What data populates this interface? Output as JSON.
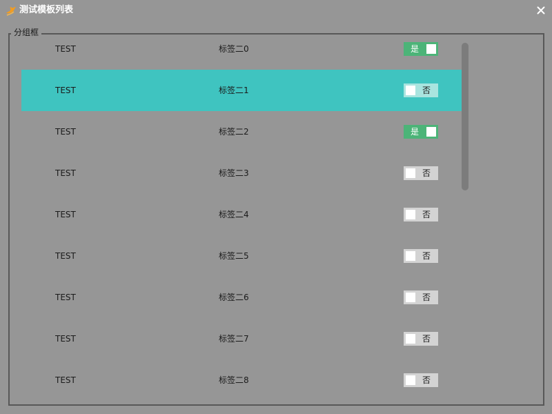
{
  "window": {
    "title": "测试模板列表",
    "app_icon": "bird-logo-icon",
    "close_icon": "close-icon"
  },
  "group": {
    "title": "分组框"
  },
  "list": {
    "selected_index": 1,
    "rows": [
      {
        "name": "TEST",
        "tag": "标签二0",
        "toggle_label": "是",
        "toggle_on": true
      },
      {
        "name": "TEST",
        "tag": "标签二1",
        "toggle_label": "否",
        "toggle_on": false
      },
      {
        "name": "TEST",
        "tag": "标签二2",
        "toggle_label": "是",
        "toggle_on": true
      },
      {
        "name": "TEST",
        "tag": "标签二3",
        "toggle_label": "否",
        "toggle_on": false
      },
      {
        "name": "TEST",
        "tag": "标签二4",
        "toggle_label": "否",
        "toggle_on": false
      },
      {
        "name": "TEST",
        "tag": "标签二5",
        "toggle_label": "否",
        "toggle_on": false
      },
      {
        "name": "TEST",
        "tag": "标签二6",
        "toggle_label": "否",
        "toggle_on": false
      },
      {
        "name": "TEST",
        "tag": "标签二7",
        "toggle_label": "否",
        "toggle_on": false
      },
      {
        "name": "TEST",
        "tag": "标签二8",
        "toggle_label": "否",
        "toggle_on": false
      }
    ]
  },
  "colors": {
    "background": "#969696",
    "selected_row": "#3fc4c0",
    "toggle_on": "#4cb478",
    "toggle_off": "#d3d3d3",
    "border": "#575757"
  }
}
